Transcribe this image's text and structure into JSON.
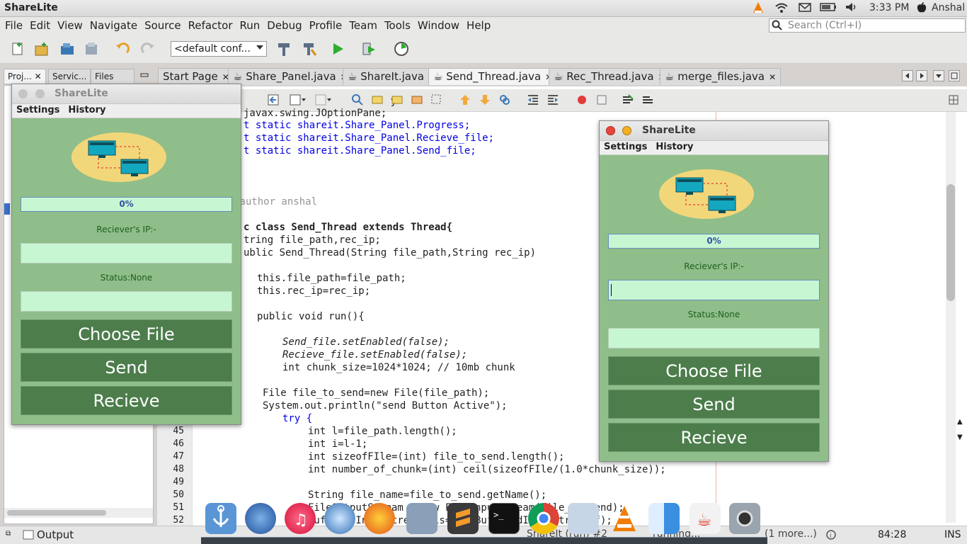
{
  "topbar": {
    "app": "ShareLite",
    "time": "3:33 PM",
    "user": "Anshal"
  },
  "menubar": {
    "items": [
      "File",
      "Edit",
      "View",
      "Navigate",
      "Source",
      "Refactor",
      "Run",
      "Debug",
      "Profile",
      "Team",
      "Tools",
      "Window",
      "Help"
    ]
  },
  "search": {
    "placeholder": "Search (Ctrl+I)"
  },
  "toolbar": {
    "config": "<default conf..."
  },
  "left_tabs": [
    "Proj...",
    "Servic...",
    "Files"
  ],
  "file_tabs": [
    {
      "label": "Start Page",
      "active": false
    },
    {
      "label": "Share_Panel.java",
      "active": false
    },
    {
      "label": "ShareIt.java",
      "active": false
    },
    {
      "label": "Send_Thread.java",
      "active": true
    },
    {
      "label": "Rec_Thread.java",
      "active": false
    },
    {
      "label": "merge_files.java",
      "active": false
    }
  ],
  "code": {
    "lines_top": [
      {
        "text": "javax.swing.JOptionPane;"
      },
      {
        "text": "t static shareit.Share_Panel.Progress;"
      },
      {
        "text": "t static shareit.Share_Panel.Recieve_file;"
      },
      {
        "text": "t static shareit.Share_Panel.Send_file;"
      }
    ],
    "author": "@author anshal",
    "class_decl": "c class Send_Thread extends Thread{",
    "fields": "tring file_path,rec_ip;",
    "constructor": "ublic Send_Thread(String file_path,String rec_ip)",
    "assign1": "this.file_path=file_path;",
    "assign2": "this.rec_ip=rec_ip;",
    "run": "public void run(){",
    "l_send": "Send_file.setEnabled(false);",
    "l_recv": "Recieve_file.setEnabled(false);",
    "l_chunk": "int chunk_size=1024*1024; // 10mb chunk",
    "l_file": "File file_to_send=new File(file_path);",
    "l_print": "System.out.println(\"send Button Active\");",
    "l_try": "try {",
    "numbered": [
      {
        "n": "45",
        "text": "int l=file_path.length();"
      },
      {
        "n": "46",
        "text": "int i=l-1;"
      },
      {
        "n": "47",
        "text": "int sizeofFIle=(int) file_to_send.length();"
      },
      {
        "n": "48",
        "text": "int number_of_chunk=(int) ceil(sizeofFIle/(1.0*chunk_size));"
      },
      {
        "n": "49",
        "text": ""
      },
      {
        "n": "50",
        "text": "String file_name=file_to_send.getName();"
      },
      {
        "n": "51",
        "text": "FileOutputStream f=new FileInputStream(file_to_send);"
      },
      {
        "n": "52",
        "text": "BufferedInputStream bis=new BufferedInputStream(f);"
      }
    ]
  },
  "statusbar": {
    "output": "Output",
    "run_label": "ShareIt (run) #2",
    "running": "running...",
    "more": "(1 more...)",
    "pos": "84:28",
    "mode": "INS"
  },
  "sharelite_left": {
    "title": "ShareLite",
    "menu": [
      "Settings",
      "History"
    ],
    "progress": "0%",
    "ip_label": "Reciever's IP:-",
    "status": "Status:None",
    "buttons": [
      "Choose File",
      "Send",
      "Recieve"
    ]
  },
  "sharelite_right": {
    "title": "ShareLite",
    "menu": [
      "Settings",
      "History"
    ],
    "progress": "0%",
    "ip_label": "Reciever's IP:-",
    "status": "Status:None",
    "buttons": [
      "Choose File",
      "Send",
      "Recieve"
    ]
  },
  "colors": {
    "panel_bg": "#8fbe8a",
    "button_bg": "#4c7d4b",
    "field_bg": "#c6f7d2",
    "keyword": "#0000e6",
    "string": "#ce7b00",
    "field": "#009900"
  }
}
